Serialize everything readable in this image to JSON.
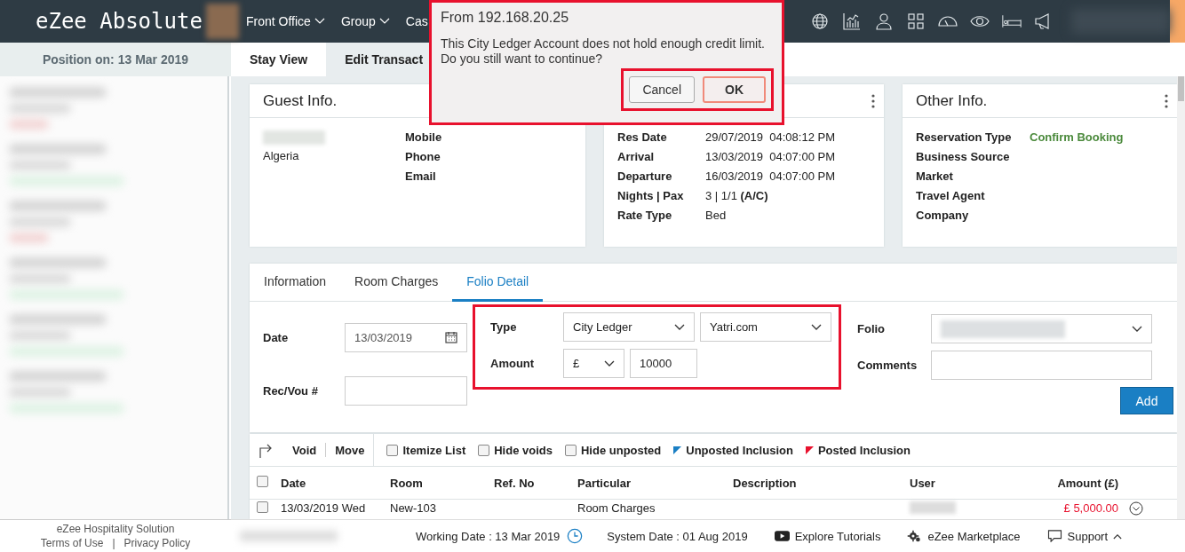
{
  "topbar": {
    "logo": "eZee Absolute",
    "nav": [
      {
        "label": "Front Office",
        "caret": true
      },
      {
        "label": "Group",
        "caret": true
      },
      {
        "label": "Cas",
        "caret": false
      }
    ]
  },
  "sidebar": {
    "position": "Position on: 13 Mar 2019",
    "company": "eZee Hospitality Solution",
    "links": [
      "Terms of Use",
      "Privacy Policy"
    ],
    "separator": "|"
  },
  "view_tabs": [
    {
      "label": "Stay View",
      "selected": true
    },
    {
      "label": "Edit Transact",
      "selected": false
    }
  ],
  "guest_card": {
    "title": "Guest Info.",
    "country": "Algeria",
    "fields": [
      "Mobile",
      "Phone",
      "Email"
    ]
  },
  "stay_card": {
    "fields": [
      {
        "label": "Res Date",
        "value": "29/07/2019  04:08:12 PM"
      },
      {
        "label": "Arrival",
        "value": "13/03/2019  04:07:00 PM"
      },
      {
        "label": "Departure",
        "value": "16/03/2019  04:07:00 PM"
      },
      {
        "label": "Nights | Pax",
        "value": "3 | 1/1 **(A/C)**"
      },
      {
        "label": "Rate Type",
        "value": "Bed"
      }
    ]
  },
  "other_card": {
    "title": "Other Info.",
    "fields": [
      {
        "label": "Reservation Type",
        "value": "Confirm Booking"
      },
      {
        "label": "Business Source"
      },
      {
        "label": "Market"
      },
      {
        "label": "Travel Agent"
      },
      {
        "label": "Company"
      }
    ]
  },
  "detail_tabs": [
    {
      "label": "Information",
      "selected": false
    },
    {
      "label": "Room Charges",
      "selected": false
    },
    {
      "label": "Folio Detail",
      "selected": true
    }
  ],
  "form": {
    "highlighted": true,
    "date": {
      "label": "Date",
      "value": "13/03/2019"
    },
    "rec_vou": {
      "label": "Rec/Vou #"
    },
    "type": {
      "label": "Type",
      "value": "City Ledger",
      "account": "Yatri.com"
    },
    "amount": {
      "label": "Amount",
      "currency": "£",
      "value": "10000"
    },
    "folio": {
      "label": "Folio"
    },
    "comments": {
      "label": "Comments"
    },
    "add_button": "Add"
  },
  "toolbar": {
    "actions": [
      "Void",
      "Move"
    ],
    "options": [
      {
        "label": "Itemize List",
        "checked": false
      },
      {
        "label": "Hide voids",
        "checked": false
      },
      {
        "label": "Hide unposted",
        "checked": false
      }
    ],
    "legend": [
      {
        "label": "Unposted Inclusion",
        "color": "#1a7fc4"
      },
      {
        "label": "Posted Inclusion",
        "color": "#e8112d"
      }
    ]
  },
  "table": {
    "all_checked": false,
    "columns": [
      "Date",
      "Room",
      "Ref. No",
      "Particular",
      "Description",
      "User",
      "Amount (£)"
    ],
    "rows": [
      {
        "checked": false,
        "date": "13/03/2019 Wed",
        "room": "New-103",
        "particular": "Room Charges",
        "amount": "£ 5,000.00"
      }
    ]
  },
  "footer": {
    "working_date": "Working Date : 13 Mar 2019",
    "system_date": "System Date : 01 Aug 2019",
    "links": [
      {
        "label": "Explore Tutorials",
        "kind": "video"
      },
      {
        "label": "eZee Marketplace",
        "kind": "gear"
      },
      {
        "label": "Support",
        "kind": "support"
      }
    ]
  },
  "dialog": {
    "title": "From 192.168.20.25",
    "message": "This City Ledger Account does not hold enough credit limit. Do you still want to continue?",
    "highlighted": true,
    "buttons_highlighted": true,
    "buttons": [
      {
        "label": "Cancel",
        "kind": "secondary"
      },
      {
        "label": "OK",
        "kind": "primary"
      }
    ]
  }
}
